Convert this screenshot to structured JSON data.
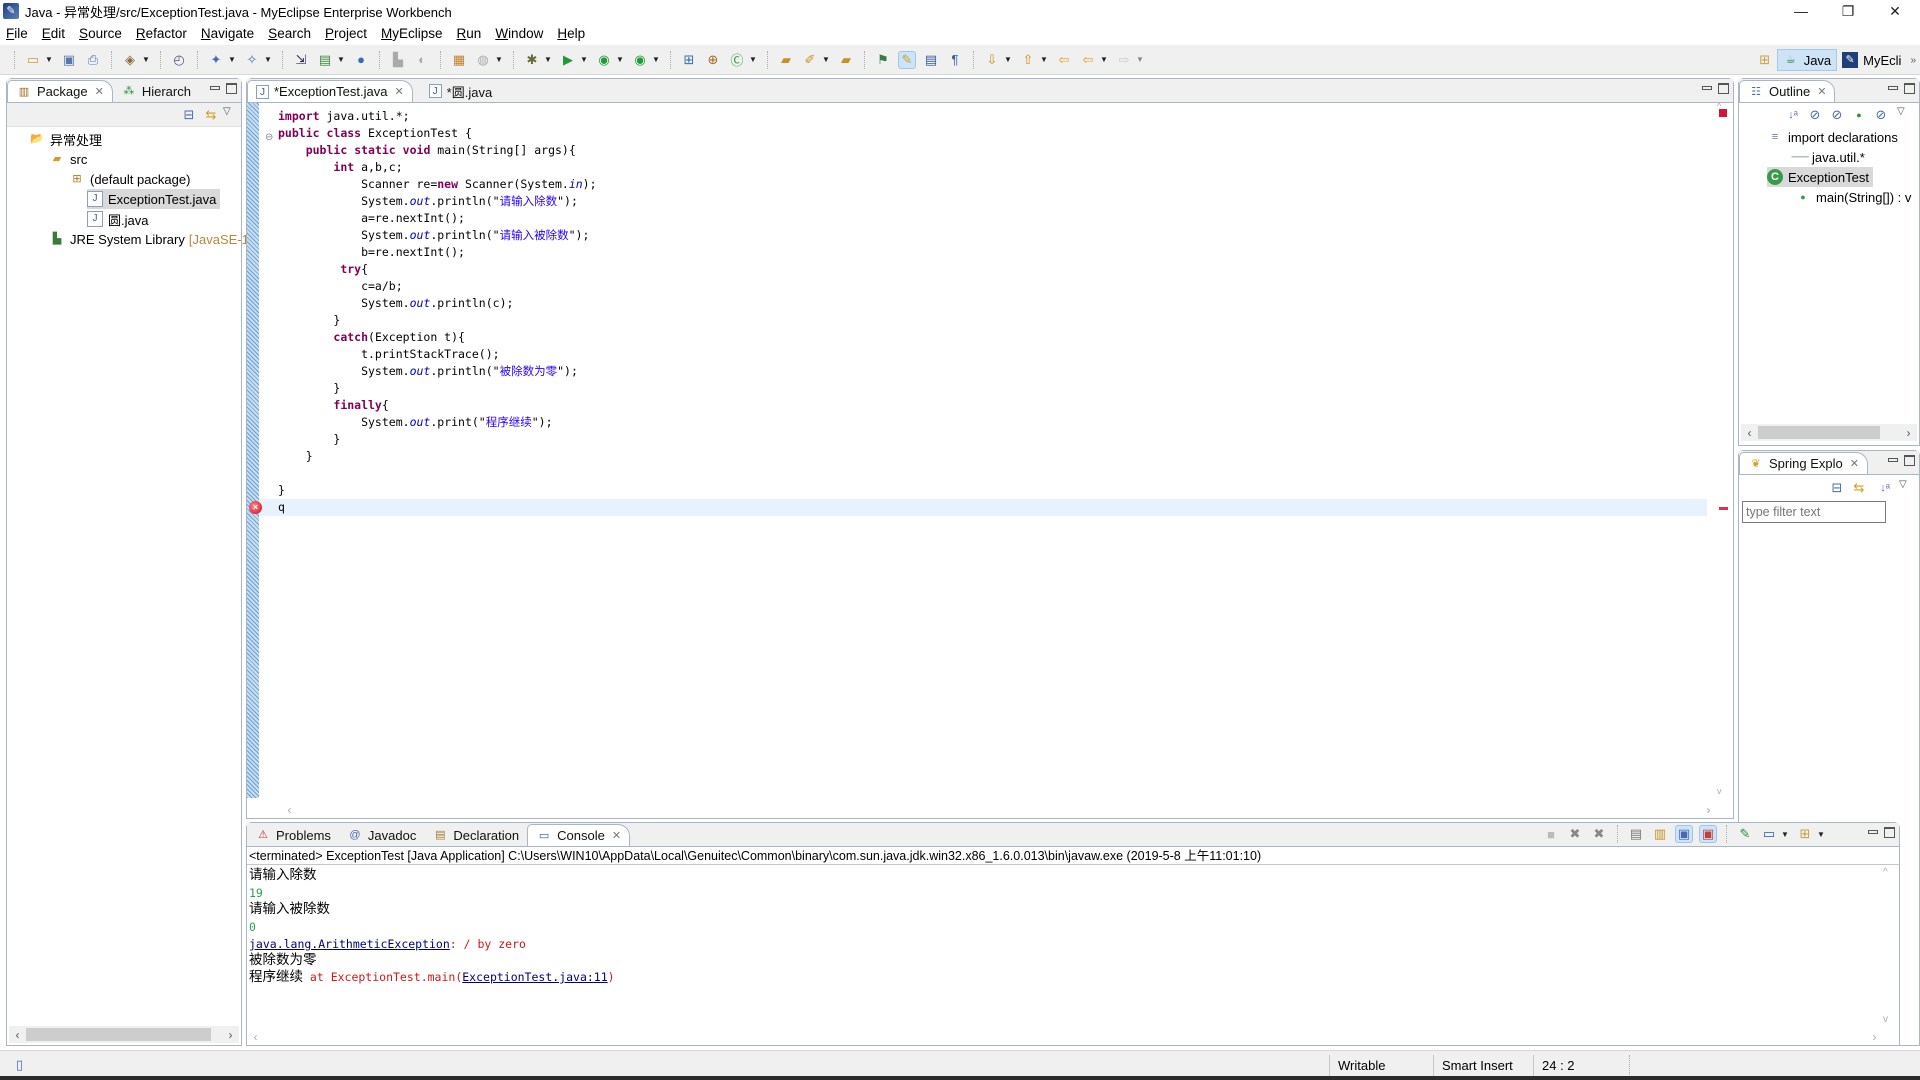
{
  "window": {
    "title": "Java - 异常处理/src/ExceptionTest.java - MyEclipse Enterprise Workbench",
    "controls": {
      "minimize": "—",
      "restore": "❐",
      "close": "✕"
    }
  },
  "menu": [
    "File",
    "Edit",
    "Source",
    "Refactor",
    "Navigate",
    "Search",
    "Project",
    "MyEclipse",
    "Run",
    "Window",
    "Help"
  ],
  "toolbar": {
    "icons": [
      "new-icon",
      "save-icon",
      "print-icon",
      "new-web-project-icon",
      "jsp-icon",
      "new-ejb-icon",
      "new-enterprise-icon",
      "deploy-icon",
      "server-icon",
      "browser-icon",
      "open-type-icon",
      "report-icon",
      "db-icon",
      "debug-icon",
      "run-icon",
      "run-profile-icon",
      "external-tools-icon",
      "new-java-project-icon",
      "new-package-icon",
      "new-class-icon",
      "open-folder-icon",
      "pen-icon",
      "open-resource-icon",
      "toggle-mark-icon",
      "highlight-icon",
      "block-selection-icon",
      "show-whitespace-icon",
      "next-annotation-icon",
      "prev-annotation-icon",
      "last-edit-icon",
      "back-icon",
      "forward-icon"
    ]
  },
  "perspectives": [
    {
      "label": "Java",
      "active": true
    },
    {
      "label": "MyEcli",
      "active": false
    }
  ],
  "package_explorer": {
    "tabs": [
      {
        "label": "Package",
        "active": true
      },
      {
        "label": "Hierarch",
        "active": false
      }
    ],
    "tree": [
      {
        "label": "异常处理",
        "icon": "java-project-icon",
        "depth": 0
      },
      {
        "label": "src",
        "icon": "source-folder-icon",
        "depth": 1
      },
      {
        "label": "(default package)",
        "icon": "package-icon",
        "depth": 2
      },
      {
        "label": "ExceptionTest.java",
        "icon": "java-file-icon",
        "depth": 3,
        "selected": true
      },
      {
        "label": "圆.java",
        "icon": "java-file-icon",
        "depth": 3
      },
      {
        "label": "JRE System Library",
        "suffix": "[JavaSE-1",
        "icon": "library-icon",
        "depth": 1
      }
    ]
  },
  "editor": {
    "tabs": [
      {
        "label": "*ExceptionTest.java",
        "active": true
      },
      {
        "label": "*圆.java",
        "active": false
      }
    ],
    "lines": [
      [
        {
          "t": "import",
          "k": "kw"
        },
        {
          "t": " java.util.*;"
        }
      ],
      [
        {
          "t": "public",
          "k": "kw"
        },
        {
          "t": " "
        },
        {
          "t": "class",
          "k": "kw"
        },
        {
          "t": " ExceptionTest {"
        }
      ],
      [
        {
          "t": "    "
        },
        {
          "t": "public",
          "k": "kw"
        },
        {
          "t": " "
        },
        {
          "t": "static",
          "k": "kw"
        },
        {
          "t": " "
        },
        {
          "t": "void",
          "k": "kw"
        },
        {
          "t": " main(String[] args){"
        }
      ],
      [
        {
          "t": "        "
        },
        {
          "t": "int",
          "k": "kw"
        },
        {
          "t": " a,b,c;"
        }
      ],
      [
        {
          "t": "            Scanner re="
        },
        {
          "t": "new",
          "k": "kw"
        },
        {
          "t": " Scanner(System."
        },
        {
          "t": "in",
          "k": "fld"
        },
        {
          "t": ");"
        }
      ],
      [
        {
          "t": "            System."
        },
        {
          "t": "out",
          "k": "fld"
        },
        {
          "t": ".println(\""
        },
        {
          "t": "请输入除数",
          "k": "str"
        },
        {
          "t": "\");"
        }
      ],
      [
        {
          "t": "            a=re.nextInt();"
        }
      ],
      [
        {
          "t": "            System."
        },
        {
          "t": "out",
          "k": "fld"
        },
        {
          "t": ".println(\""
        },
        {
          "t": "请输入被除数",
          "k": "str"
        },
        {
          "t": "\");"
        }
      ],
      [
        {
          "t": "            b=re.nextInt();"
        }
      ],
      [
        {
          "t": "         "
        },
        {
          "t": "try",
          "k": "kw"
        },
        {
          "t": "{"
        }
      ],
      [
        {
          "t": "            c=a/b;"
        }
      ],
      [
        {
          "t": "            System."
        },
        {
          "t": "out",
          "k": "fld"
        },
        {
          "t": ".println(c);"
        }
      ],
      [
        {
          "t": "        }"
        }
      ],
      [
        {
          "t": "        "
        },
        {
          "t": "catch",
          "k": "kw"
        },
        {
          "t": "(Exception t){"
        }
      ],
      [
        {
          "t": "            t.printStackTrace();"
        }
      ],
      [
        {
          "t": "            System."
        },
        {
          "t": "out",
          "k": "fld"
        },
        {
          "t": ".println(\""
        },
        {
          "t": "被除数为零",
          "k": "str"
        },
        {
          "t": "\");"
        }
      ],
      [
        {
          "t": "        }"
        }
      ],
      [
        {
          "t": "        "
        },
        {
          "t": "finally",
          "k": "kw"
        },
        {
          "t": "{"
        }
      ],
      [
        {
          "t": "            System."
        },
        {
          "t": "out",
          "k": "fld"
        },
        {
          "t": ".print(\""
        },
        {
          "t": "程序继续",
          "k": "str"
        },
        {
          "t": "\");"
        }
      ],
      [
        {
          "t": "        }"
        }
      ],
      [
        {
          "t": "    }"
        }
      ],
      [
        {
          "t": ""
        }
      ],
      [
        {
          "t": "}"
        }
      ],
      [
        {
          "t": "q"
        }
      ]
    ],
    "current_line": 24,
    "error_line": 24
  },
  "outline": {
    "tab_label": "Outline",
    "items": [
      {
        "label": "import declarations",
        "icon": "imports-icon",
        "depth": 0
      },
      {
        "label": "java.util.*",
        "icon": "import-icon",
        "depth": 1
      },
      {
        "label": "ExceptionTest",
        "icon": "class-icon",
        "depth": 0,
        "selected": true
      },
      {
        "label": "main(String[]) : v",
        "icon": "method-icon",
        "depth": 1
      }
    ]
  },
  "spring_explorer": {
    "tab_label": "Spring Explo",
    "filter_placeholder": "type filter text"
  },
  "bottom_panel": {
    "tabs": [
      {
        "label": "Problems",
        "icon": "problems-icon",
        "active": false
      },
      {
        "label": "Javadoc",
        "icon": "at-icon",
        "active": false
      },
      {
        "label": "Declaration",
        "icon": "declaration-icon",
        "active": false
      },
      {
        "label": "Console",
        "icon": "console-icon",
        "active": true
      }
    ],
    "console_header": "<terminated> ExceptionTest [Java Application] C:\\Users\\WIN10\\AppData\\Local\\Genuitec\\Common\\binary\\com.sun.java.jdk.win32.x86_1.6.0.013\\bin\\javaw.exe (2019-5-8 上午11:01:10)",
    "output": {
      "line1": "请输入除数",
      "input1": "19",
      "line2": "请输入被除数",
      "input2": "0",
      "exception_class": "java.lang.ArithmeticException",
      "exception_msg": ": / by zero",
      "line3": "被除数为零",
      "line4": "程序继续",
      "stack_prefix": " at ExceptionTest.main(",
      "stack_link": "ExceptionTest.java:11",
      "stack_suffix": ")"
    }
  },
  "status_bar": {
    "writable": "Writable",
    "insert_mode": "Smart Insert",
    "position": "24 : 2"
  }
}
